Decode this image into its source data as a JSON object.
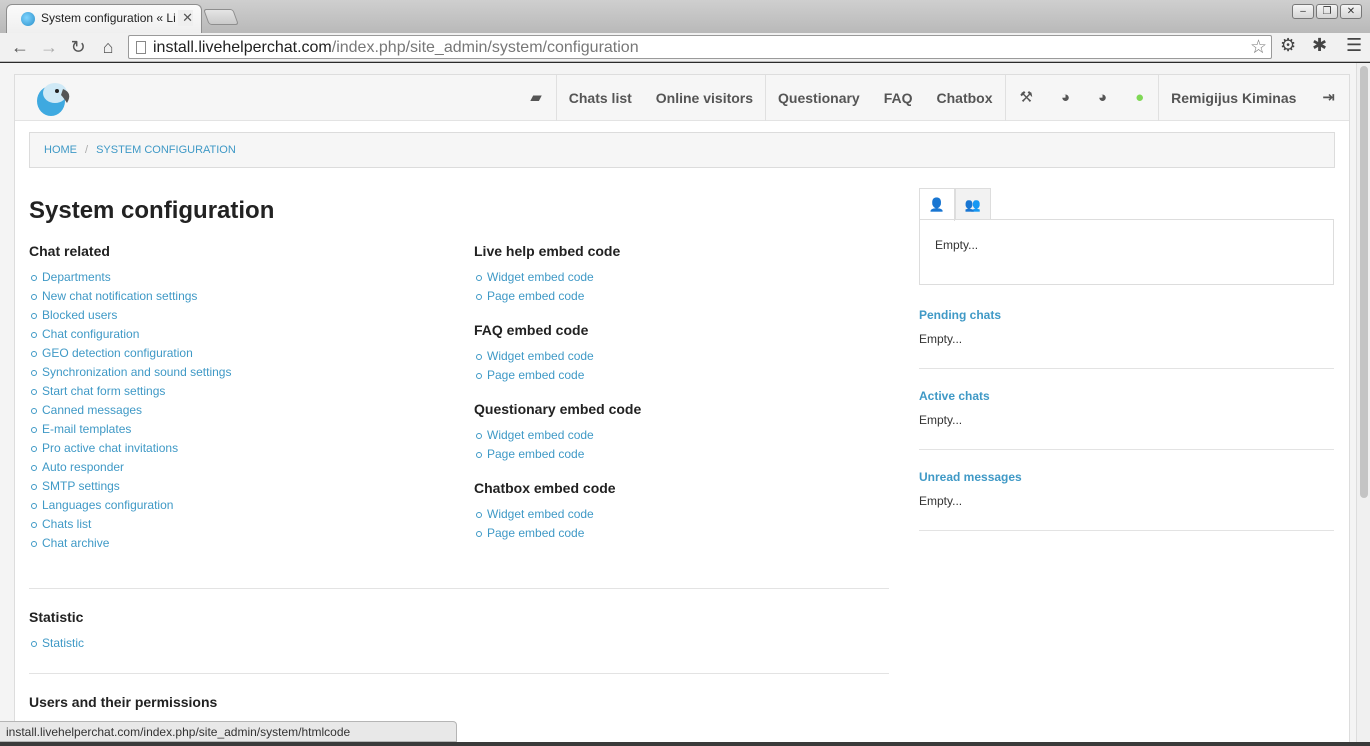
{
  "browser": {
    "tab_title": "System configuration « Li",
    "url_host": "install.livehelperchat.com",
    "url_path": "/index.php/site_admin/system/configuration",
    "status_url": "install.livehelperchat.com/index.php/site_admin/system/htmlcode"
  },
  "topnav": {
    "chats_list": "Chats list",
    "online_visitors": "Online visitors",
    "questionary": "Questionary",
    "faq": "FAQ",
    "chatbox": "Chatbox",
    "user_name": "Remigijus Kiminas"
  },
  "breadcrumb": {
    "home": "HOME",
    "current": "SYSTEM CONFIGURATION"
  },
  "page_title": "System configuration",
  "chat_related": {
    "title": "Chat related",
    "links": [
      "Departments",
      "New chat notification settings",
      "Blocked users",
      "Chat configuration",
      "GEO detection configuration",
      "Synchronization and sound settings",
      "Start chat form settings",
      "Canned messages",
      "E-mail templates",
      "Pro active chat invitations",
      "Auto responder",
      "SMTP settings",
      "Languages configuration",
      "Chats list",
      "Chat archive"
    ]
  },
  "embed_sections": [
    {
      "title": "Live help embed code",
      "links": [
        "Widget embed code",
        "Page embed code"
      ]
    },
    {
      "title": "FAQ embed code",
      "links": [
        "Widget embed code",
        "Page embed code"
      ]
    },
    {
      "title": "Questionary embed code",
      "links": [
        "Widget embed code",
        "Page embed code"
      ]
    },
    {
      "title": "Chatbox embed code",
      "links": [
        "Widget embed code",
        "Page embed code"
      ]
    }
  ],
  "statistic": {
    "title": "Statistic",
    "links": [
      "Statistic"
    ]
  },
  "users_section": {
    "title": "Users and their permissions"
  },
  "sidebar": {
    "box_empty": "Empty...",
    "pending_title": "Pending chats",
    "pending_empty": "Empty...",
    "active_title": "Active chats",
    "active_empty": "Empty...",
    "unread_title": "Unread messages",
    "unread_empty": "Empty..."
  },
  "colors": {
    "link": "#3f99c6",
    "online_user": "#7fd855"
  }
}
